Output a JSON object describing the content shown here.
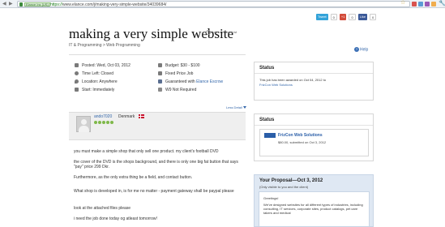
{
  "browser": {
    "ev_badge": "Elance Inc [US]",
    "url_scheme": "https://",
    "url_host": "www.elance.com",
    "url_path": "/j/making-very-simple-website/34039684/",
    "back_glyph": "◀",
    "forward_glyph": "▶",
    "star_glyph": "☆",
    "wrench_glyph": "🔧"
  },
  "share": {
    "tweet_label": "Tweet",
    "tweet_count": "0",
    "gplus_label": "+1",
    "gplus_count": "0",
    "like_label": "Like",
    "like_count": "0"
  },
  "job": {
    "title": "making a very simple website",
    "watch_label": "Add to Watch List",
    "breadcrumb": "IT & Programming > Web Programming",
    "help_label": "Help",
    "posted": "Posted:  Wed, Oct 03, 2012",
    "time_left": "Time Left:  Closed",
    "location": "Location:  Anywhere",
    "start": "Start:  Immediately",
    "budget": "Budget:  $30 - $100",
    "job_type": "Fixed Price Job",
    "escrow_prefix": "Guaranteed with",
    "escrow_link": "Elance Escrow",
    "w9": "W9 Not Required",
    "less_detail": "Less Detail"
  },
  "client": {
    "username": "ando7020",
    "country": "Denmark"
  },
  "description": [
    "you must make a simple shop that only sell one product. my client's football DVD",
    "the cover of the DVD is the shops background, and there is only one big fat button that says \"pay\" price 299 Dkr.",
    "Furthermore, as the only extra thing be a field, and contact button.",
    "What shop is developed in, is for me no matter - payment gateway shall be paypal please",
    "look at the attached files please",
    "i need the job done today og atleast tomorrow!"
  ],
  "sidebar": {
    "status_heading": "Status",
    "awarded_text": "This job has been awarded on Oct 04, 2012 to",
    "awarded_to": "FrizCon Web Solutions",
    "status2_heading": "Status",
    "bidder_name": "FrizCon Web Solutions",
    "bid_info": "$80.00, submitted on Oct 3, 2012",
    "proposal_title": "Your Proposal—Oct 3, 2012",
    "proposal_sub": "(Only visible to you and the client)",
    "greeting": "Greetings!",
    "proposal_body": "We've designed websites for all different types of industries, including consulting, IT services, corporate sites, product catalogs, pet care takers and medical"
  },
  "colors": {
    "link": "#3366aa",
    "tweet": "#33a3d9",
    "gplus": "#d24b3a",
    "facebook": "#3b5998",
    "proposal_bg": "#dfe8f3"
  }
}
